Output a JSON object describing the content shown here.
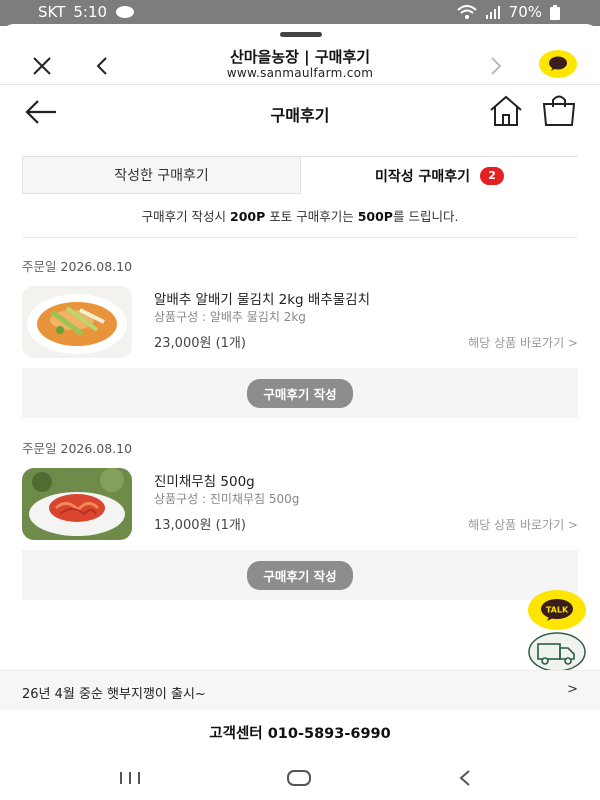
{
  "status": {
    "carrier": "SKT",
    "time": "5:10",
    "battery": "70%"
  },
  "browser": {
    "title": "산마을농장 | 구매후기",
    "url": "www.sanmaulfarm.com"
  },
  "page": {
    "title": "구매후기"
  },
  "tabs": [
    {
      "label": "작성한 구매후기"
    },
    {
      "label": "미작성 구매후기",
      "badge": "2"
    }
  ],
  "notice": {
    "pre": "구매후기 작성시 ",
    "p1": "200P",
    "mid": " 포토 구매후기는 ",
    "p2": "500P",
    "post": "를 드립니다."
  },
  "orders": [
    {
      "date_label": "주문일",
      "date": "2026.08.10",
      "name": "알배추 알배기 물김치 2kg 배추물김치",
      "config": "상품구성 : 알배추 물김치 2kg",
      "price": "23,000원 (1개)",
      "link": "해당 상품 바로가기 >",
      "review_btn": "구매후기 작성"
    },
    {
      "date_label": "주문일",
      "date": "2026.08.10",
      "name": "진미채무침 500g",
      "config": "상품구성 : 진미채무침 500g",
      "price": "13,000원 (1개)",
      "link": "해당 상품 바로가기 >",
      "review_btn": "구매후기 작성"
    }
  ],
  "floating": {
    "talk_label": "TALK"
  },
  "promo": {
    "text": "26년 4월 중순 햇부지깽이 출시~",
    "chevron": ">"
  },
  "footer": {
    "cs": "고객센터 010-5893-6990"
  },
  "colors": {
    "kakao": "#FEE500",
    "badge": "#E52020",
    "review_btn": "#8D8D8D"
  }
}
